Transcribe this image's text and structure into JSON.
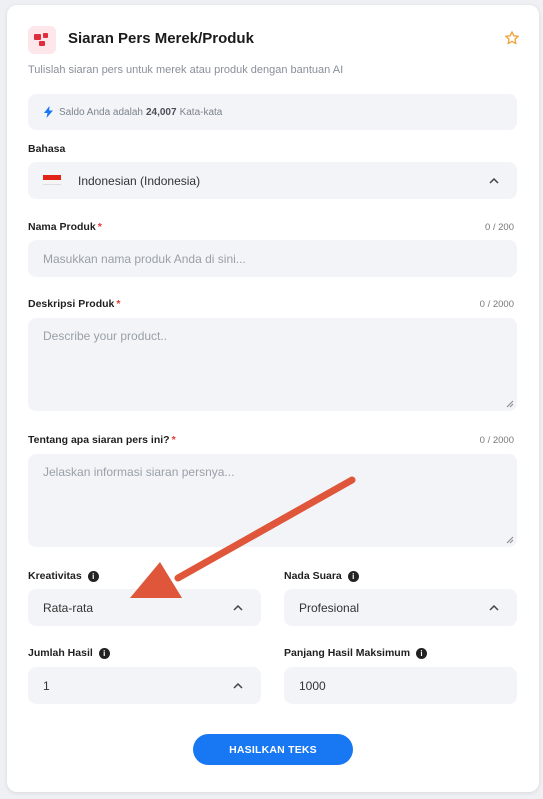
{
  "header": {
    "title": "Siaran Pers Merek/Produk",
    "subtitle": "Tulislah siaran pers untuk merek atau produk dengan bantuan AI"
  },
  "saldo": {
    "prefix": "Saldo Anda adalah",
    "amount": "24,007",
    "suffix": "Kata-kata"
  },
  "bahasa": {
    "label": "Bahasa",
    "value": "Indonesian (Indonesia)"
  },
  "nama_produk": {
    "label": "Nama Produk",
    "counter": "0 / 200",
    "placeholder": "Masukkan nama produk Anda di sini..."
  },
  "deskripsi_produk": {
    "label": "Deskripsi Produk",
    "counter": "0 / 2000",
    "placeholder": "Describe your product.."
  },
  "tentang": {
    "label": "Tentang apa siaran pers ini?",
    "counter": "0 / 2000",
    "placeholder": "Jelaskan informasi siaran persnya..."
  },
  "kreativitas": {
    "label": "Kreativitas",
    "value": "Rata-rata"
  },
  "nada_suara": {
    "label": "Nada Suara",
    "value": "Profesional"
  },
  "jumlah_hasil": {
    "label": "Jumlah Hasil",
    "value": "1"
  },
  "panjang_hasil": {
    "label": "Panjang Hasil Maksimum",
    "value": "1000"
  },
  "submit": {
    "label": "HASILKAN TEKS"
  },
  "colors": {
    "accent": "#1877f2",
    "required": "#e53935",
    "annotation_arrow": "#e0563b",
    "field_bg": "#f2f4f7"
  }
}
